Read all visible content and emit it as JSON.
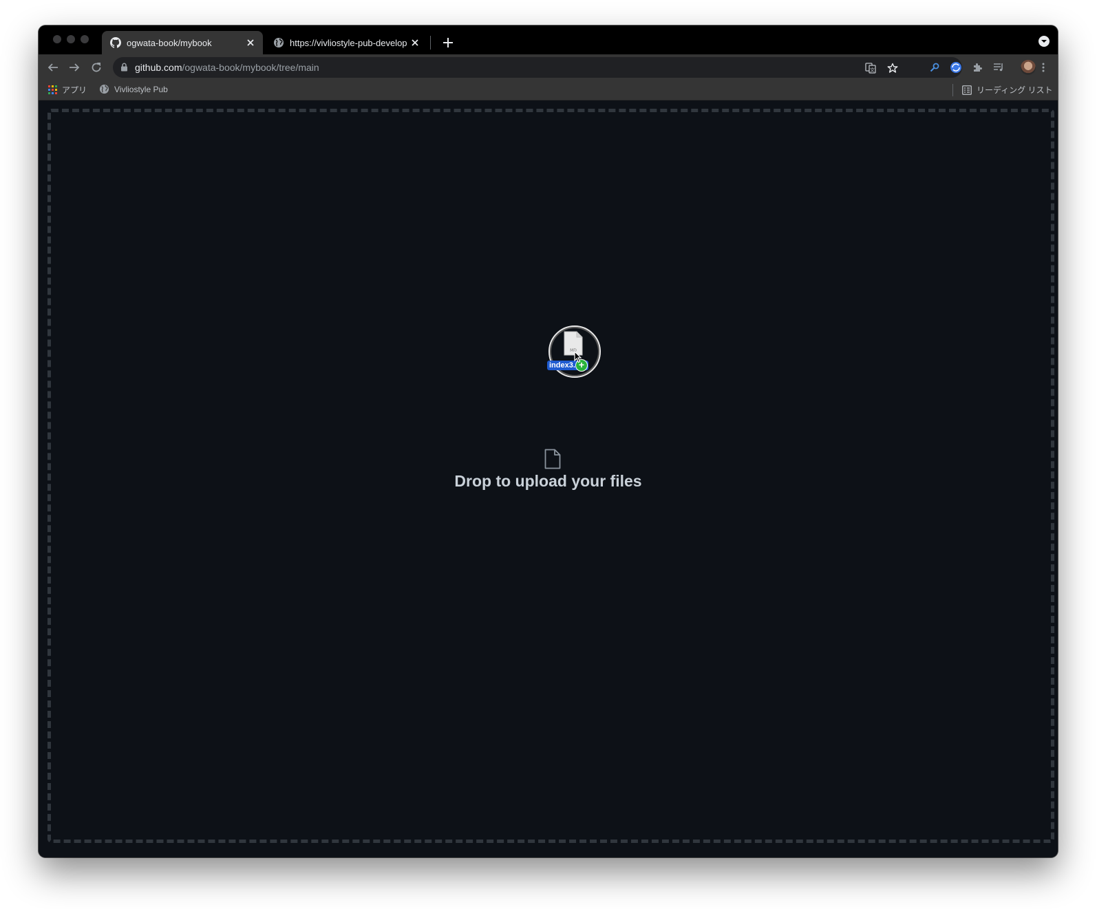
{
  "browser": {
    "tabs": [
      {
        "title": "ogwata-book/mybook",
        "favicon": "github-icon",
        "active": true
      },
      {
        "title": "https://vivliostyle-pub-develop",
        "favicon": "globe-icon",
        "active": false
      }
    ],
    "new_tab_label": "+",
    "address": {
      "host": "github.com",
      "path": "/ogwata-book/mybook/tree/main"
    },
    "bookmarks": [
      {
        "label": "アプリ",
        "icon": "apps-grid-icon"
      },
      {
        "label": "Vivliostyle Pub",
        "icon": "globe-icon"
      }
    ],
    "reading_list_label": "リーディング リスト"
  },
  "page": {
    "drop_message": "Drop to upload your files",
    "drag_file_label": "index3.md",
    "drag_file_badge": "MD"
  },
  "colors": {
    "page_bg": "#0d1117",
    "dropzone_border": "#30363d",
    "drop_text": "#c9d1d9",
    "drag_label_bg": "#1e5bd0",
    "copy_badge": "#28b33b"
  }
}
